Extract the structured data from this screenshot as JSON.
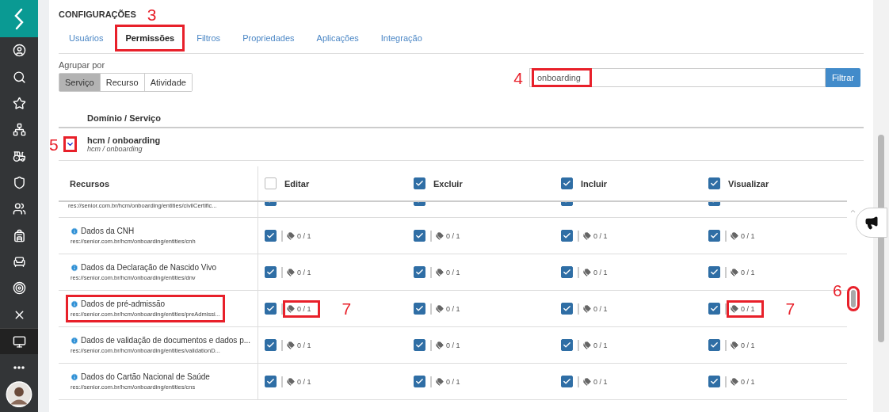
{
  "sidebar": {
    "items": [
      {
        "selected": false
      },
      {
        "selected": false
      },
      {
        "selected": false
      },
      {
        "selected": false
      },
      {
        "selected": false
      },
      {
        "selected": false
      },
      {
        "selected": false
      },
      {
        "selected": false
      },
      {
        "selected": false
      },
      {
        "selected": false
      },
      {
        "selected": false
      },
      {
        "selected": true
      },
      {
        "selected": false
      }
    ]
  },
  "page": {
    "title": "CONFIGURAÇÕES",
    "annotation": "3"
  },
  "tabs": [
    {
      "label": "Usuários",
      "selected": false,
      "highlighted": false
    },
    {
      "label": "Permissões",
      "selected": true,
      "highlighted": true
    },
    {
      "label": "Filtros",
      "selected": false,
      "highlighted": false
    },
    {
      "label": "Propriedades",
      "selected": false,
      "highlighted": false
    },
    {
      "label": "Aplicações",
      "selected": false,
      "highlighted": false
    },
    {
      "label": "Integração",
      "selected": false,
      "highlighted": false
    }
  ],
  "group_by": {
    "label": "Agrupar por",
    "options": [
      {
        "label": "Serviço",
        "selected": true
      },
      {
        "label": "Recurso",
        "selected": false
      },
      {
        "label": "Atividade",
        "selected": false
      }
    ]
  },
  "filter": {
    "value": "onboarding",
    "highlighted": true,
    "annotation": "4",
    "button": "Filtrar"
  },
  "domain_header": "Domínio / Serviço",
  "domain": {
    "name": "hcm / onboarding",
    "subtitle": "hcm / onboarding",
    "expanded": true,
    "highlighted": true,
    "annotation": "5"
  },
  "resources": {
    "column_header": "Recursos",
    "columns": [
      {
        "label": "Editar",
        "checked": false
      },
      {
        "label": "Excluir",
        "checked": true
      },
      {
        "label": "Incluir",
        "checked": true
      },
      {
        "label": "Visualizar",
        "checked": true
      }
    ],
    "rows": [
      {
        "kind": "partial",
        "url": "res://senior.com.br/hcm/onboarding/entities/civilCertific...",
        "cells": [
          {
            "checked": true
          },
          {
            "checked": true
          },
          {
            "checked": true
          },
          {
            "checked": true
          }
        ]
      },
      {
        "kind": "full",
        "name": "Dados da CNH",
        "url": "res://senior.com.br/hcm/onboarding/entities/cnh",
        "highlighted": false,
        "cells": [
          {
            "checked": true,
            "count": "0 / 1"
          },
          {
            "checked": true,
            "count": "0 / 1"
          },
          {
            "checked": true,
            "count": "0 / 1"
          },
          {
            "checked": true,
            "count": "0 / 1"
          }
        ]
      },
      {
        "kind": "full",
        "name": "Dados da Declaração de Nascido Vivo",
        "url": "res://senior.com.br/hcm/onboarding/entities/dnv",
        "highlighted": false,
        "cells": [
          {
            "checked": true,
            "count": "0 / 1"
          },
          {
            "checked": true,
            "count": "0 / 1"
          },
          {
            "checked": true,
            "count": "0 / 1"
          },
          {
            "checked": true,
            "count": "0 / 1"
          }
        ]
      },
      {
        "kind": "full",
        "name": "Dados de pré-admissão",
        "url": "res://senior.com.br/hcm/onboarding/entities/preAdmissi...",
        "highlighted": true,
        "cells": [
          {
            "checked": true,
            "count": "0 / 1",
            "highlighted": true,
            "annotation": "7"
          },
          {
            "checked": true,
            "count": "0 / 1"
          },
          {
            "checked": true,
            "count": "0 / 1"
          },
          {
            "checked": true,
            "count": "0 / 1",
            "highlighted": true,
            "annotation": "7"
          }
        ]
      },
      {
        "kind": "full",
        "name": "Dados de validação de documentos e dados p...",
        "url": "res://senior.com.br/hcm/onboarding/entities/validationD...",
        "highlighted": false,
        "cells": [
          {
            "checked": true,
            "count": "0 / 1"
          },
          {
            "checked": true,
            "count": "0 / 1"
          },
          {
            "checked": true,
            "count": "0 / 1"
          },
          {
            "checked": true,
            "count": "0 / 1"
          }
        ]
      },
      {
        "kind": "full",
        "name": "Dados do Cartão Nacional de Saúde",
        "url": "res://senior.com.br/hcm/onboarding/entities/cns",
        "highlighted": false,
        "cells": [
          {
            "checked": true,
            "count": "0 / 1"
          },
          {
            "checked": true,
            "count": "0 / 1"
          },
          {
            "checked": true,
            "count": "0 / 1"
          },
          {
            "checked": true,
            "count": "0 / 1"
          }
        ]
      }
    ]
  },
  "scrollbar": {
    "highlighted": true,
    "annotation": "6"
  }
}
